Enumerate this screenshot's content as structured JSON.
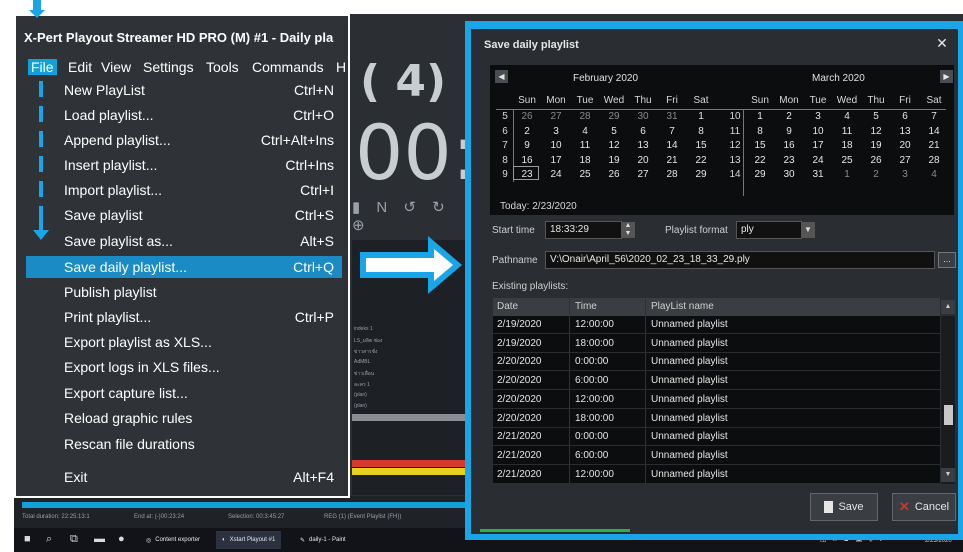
{
  "background": {
    "timer": "( 4)",
    "clock": "00:0",
    "toolbar_glyphs": "▮ N ↺ ↻ ⊕",
    "status_items": [
      "Total duration: 22:25:13:1",
      "End at: (-)00:23:24",
      "Selection: 00:3:45:27",
      "REG (1) (Event Playlist (FH))"
    ],
    "list_items": [
      "indeks 1",
      "LS_ผลิต ช่อง",
      "ข่าวสารชั่ง",
      "AdMBL",
      "ข่าวเลื่อน",
      "ละคร 1",
      "(plan)",
      "(plan)"
    ]
  },
  "taskbar": {
    "tasks": [
      {
        "label": "Content exporter",
        "icon": "globe-icon",
        "active": false
      },
      {
        "label": "Xstart Playout #1",
        "icon": "app-icon",
        "active": true
      },
      {
        "label": "daily-1 - Paint",
        "icon": "paint-icon",
        "active": false
      }
    ],
    "clock": "2/23/2020"
  },
  "menu_window": {
    "title": "X-Pert Playout Streamer HD PRO (M) #1 - Daily pla",
    "menubar": [
      "File",
      "Edit",
      "View",
      "Settings",
      "Tools",
      "Commands",
      "H"
    ],
    "items": [
      {
        "label": "New PlayList",
        "shortcut": "Ctrl+N"
      },
      {
        "label": "Load playlist...",
        "shortcut": "Ctrl+O"
      },
      {
        "label": "Append playlist...",
        "shortcut": "Ctrl+Alt+Ins"
      },
      {
        "label": "Insert playlist...",
        "shortcut": "Ctrl+Ins"
      },
      {
        "label": "Import playlist...",
        "shortcut": "Ctrl+I"
      },
      {
        "label": "Save playlist",
        "shortcut": "Ctrl+S"
      },
      {
        "label": "Save playlist as...",
        "shortcut": "Alt+S"
      },
      {
        "label": "Save daily playlist...",
        "shortcut": "Ctrl+Q"
      },
      {
        "label": "Publish playlist",
        "shortcut": ""
      },
      {
        "label": "Print playlist...",
        "shortcut": "Ctrl+P"
      },
      {
        "label": "Export playlist as XLS...",
        "shortcut": ""
      },
      {
        "label": "Export logs in XLS files...",
        "shortcut": ""
      },
      {
        "label": "Export capture list...",
        "shortcut": ""
      },
      {
        "label": "Reload graphic rules",
        "shortcut": ""
      },
      {
        "label": "Rescan file durations",
        "shortcut": ""
      },
      {
        "label": "Exit",
        "shortcut": "Alt+F4"
      }
    ],
    "selected_index": 7
  },
  "dialog": {
    "title": "Save daily playlist",
    "calendar": {
      "left": {
        "month": "February 2020",
        "days_header": [
          "Sun",
          "Mon",
          "Tue",
          "Wed",
          "Thu",
          "Fri",
          "Sat"
        ],
        "weeks": [
          {
            "wk": "5",
            "days": [
              "26",
              "27",
              "28",
              "29",
              "30",
              "31",
              "1"
            ]
          },
          {
            "wk": "6",
            "days": [
              "2",
              "3",
              "4",
              "5",
              "6",
              "7",
              "8"
            ]
          },
          {
            "wk": "7",
            "days": [
              "9",
              "10",
              "11",
              "12",
              "13",
              "14",
              "15"
            ]
          },
          {
            "wk": "8",
            "days": [
              "16",
              "17",
              "18",
              "19",
              "20",
              "21",
              "22"
            ]
          },
          {
            "wk": "9",
            "days": [
              "23",
              "24",
              "25",
              "26",
              "27",
              "28",
              "29"
            ]
          }
        ]
      },
      "right": {
        "month": "March 2020",
        "days_header": [
          "Sun",
          "Mon",
          "Tue",
          "Wed",
          "Thu",
          "Fri",
          "Sat"
        ],
        "weeks": [
          {
            "wk": "10",
            "days": [
              "1",
              "2",
              "3",
              "4",
              "5",
              "6",
              "7"
            ]
          },
          {
            "wk": "11",
            "days": [
              "8",
              "9",
              "10",
              "11",
              "12",
              "13",
              "14"
            ]
          },
          {
            "wk": "12",
            "days": [
              "15",
              "16",
              "17",
              "18",
              "19",
              "20",
              "21"
            ]
          },
          {
            "wk": "13",
            "days": [
              "22",
              "23",
              "24",
              "25",
              "26",
              "27",
              "28"
            ]
          },
          {
            "wk": "14",
            "days": [
              "29",
              "30",
              "31",
              "1",
              "2",
              "3",
              "4"
            ]
          }
        ]
      },
      "today": "Today: 2/23/2020"
    },
    "start_time_label": "Start time",
    "start_time_value": "18:33:29",
    "format_label": "Playlist format",
    "format_value": "ply",
    "pathname_label": "Pathname",
    "pathname_value": "V:\\Onair\\April_56\\2020_02_23_18_33_29.ply",
    "browse_label": "...",
    "existing_label": "Existing playlists:",
    "columns": [
      "Date",
      "Time",
      "PlayList name"
    ],
    "rows": [
      [
        "2/19/2020",
        "12:00:00",
        "Unnamed playlist"
      ],
      [
        "2/19/2020",
        "18:00:00",
        "Unnamed playlist"
      ],
      [
        "2/20/2020",
        "0:00:00",
        "Unnamed playlist"
      ],
      [
        "2/20/2020",
        "6:00:00",
        "Unnamed playlist"
      ],
      [
        "2/20/2020",
        "12:00:00",
        "Unnamed playlist"
      ],
      [
        "2/20/2020",
        "18:00:00",
        "Unnamed playlist"
      ],
      [
        "2/21/2020",
        "0:00:00",
        "Unnamed playlist"
      ],
      [
        "2/21/2020",
        "6:00:00",
        "Unnamed playlist"
      ],
      [
        "2/21/2020",
        "12:00:00",
        "Unnamed playlist"
      ]
    ],
    "save_label": "Save",
    "cancel_label": "Cancel"
  },
  "colors": {
    "accent": "#1aa5e8",
    "menu_selected": "#1a8bc4",
    "dialog_bg": "#2a2d31"
  }
}
